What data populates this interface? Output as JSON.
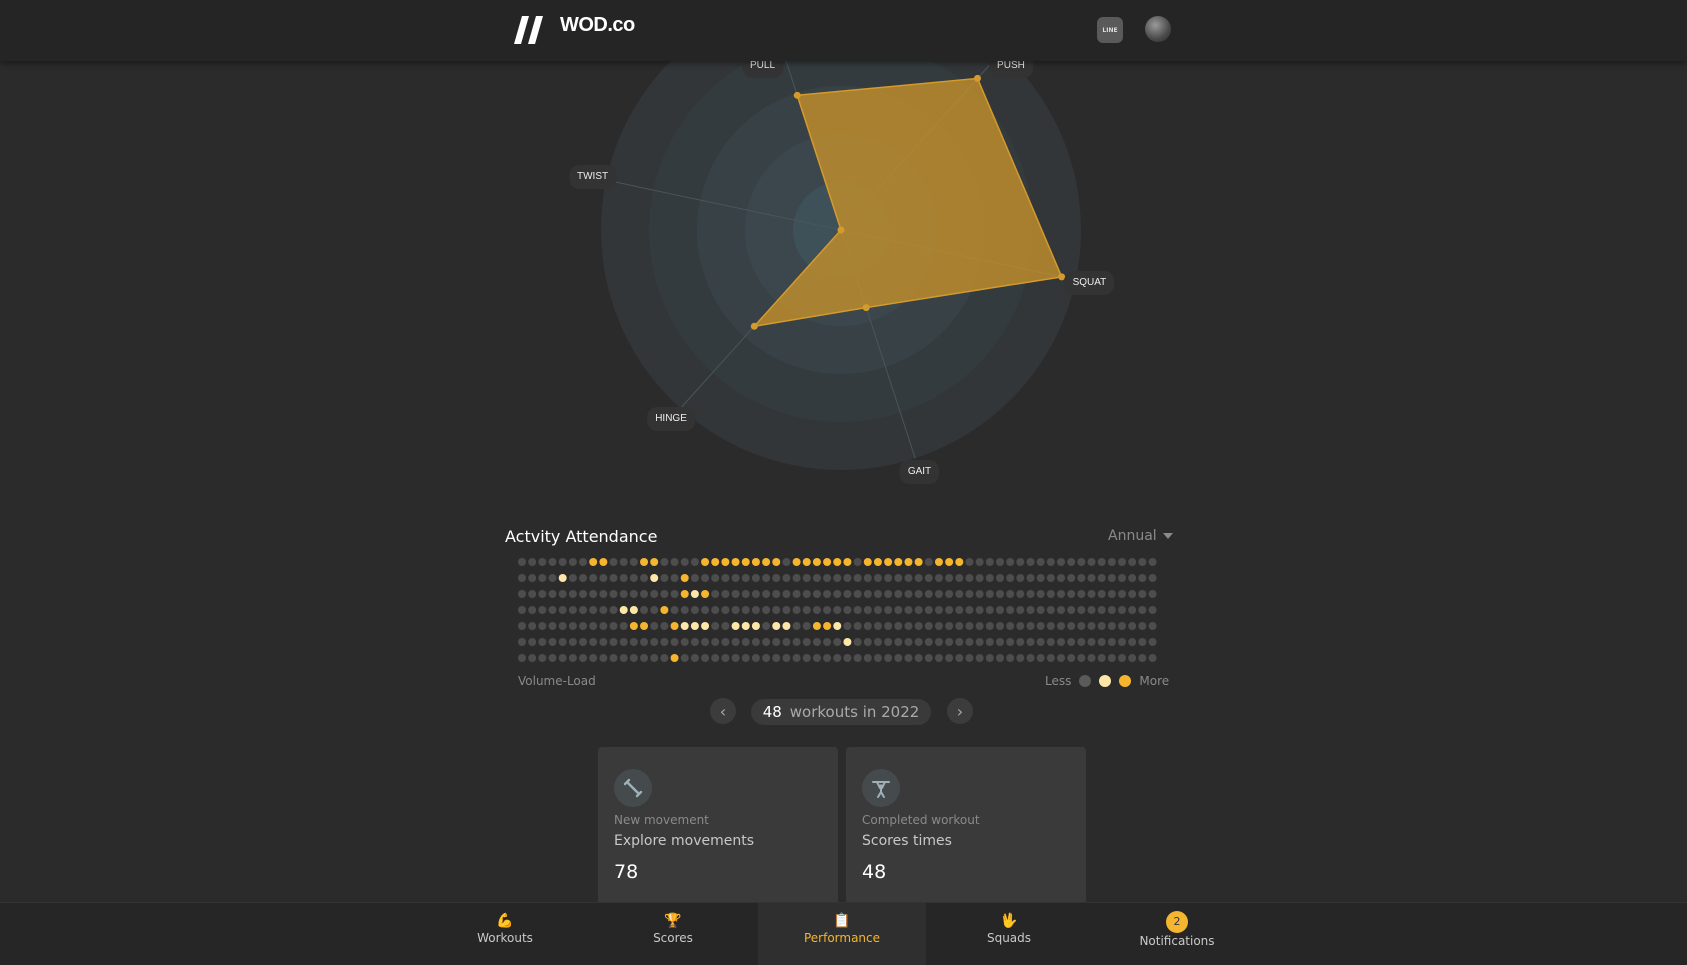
{
  "header": {
    "brand": "WOD.co",
    "chat_label": "LINE"
  },
  "radar": {
    "axes": [
      {
        "label": "PUSH",
        "value": 0.85
      },
      {
        "label": "SQUAT",
        "value": 0.94
      },
      {
        "label": "GAIT",
        "value": 0.34
      },
      {
        "label": "HINGE",
        "value": 0.54
      },
      {
        "label": "TWIST",
        "value": 0.0
      },
      {
        "label": "PULL",
        "value": 0.59
      }
    ],
    "rings": 5,
    "colors": {
      "fill": "#c8922a",
      "stroke": "#d49a2c",
      "ring": "#3e5058",
      "outer": "#323638"
    }
  },
  "attendance": {
    "title": "Actvity Attendance",
    "range": "Annual",
    "volume_label": "Volume-Load",
    "legend_less": "Less",
    "legend_more": "More",
    "colors": {
      "empty": "#4d4d4d",
      "light": "#fde6a8",
      "strong": "#f5b52f"
    },
    "rows": [
      "000000066000660000666666660666666066666606660000000000000000000",
      "000040000000040030000000000000000000000000000000000000000000000",
      "000000000000000034600000000000000000000000000000000000000000000",
      "000000000044006000000000000000000000000000000000000000000000000",
      "000000000006600344400444044003340000000000000000000000000000000",
      "000000000000000000000000000000004000000000000000000000000000000",
      "000000000000000300000000000000000000000000000000000000000000000"
    ],
    "workouts_count": "48",
    "workouts_text": "workouts in 2022"
  },
  "cards": [
    {
      "small": "New movement",
      "mid": "Explore movements",
      "value": "78",
      "icon": "dumbbell-icon"
    },
    {
      "small": "Completed workout",
      "mid": "Scores times",
      "value": "48",
      "icon": "weightlifter-icon"
    }
  ],
  "tabs": [
    {
      "label": "Workouts",
      "icon": "💪"
    },
    {
      "label": "Scores",
      "icon": "🏆"
    },
    {
      "label": "Performance",
      "icon": "📋",
      "active": true
    },
    {
      "label": "Squads",
      "icon": "🖖"
    },
    {
      "label": "Notifications",
      "badge": "2"
    }
  ]
}
